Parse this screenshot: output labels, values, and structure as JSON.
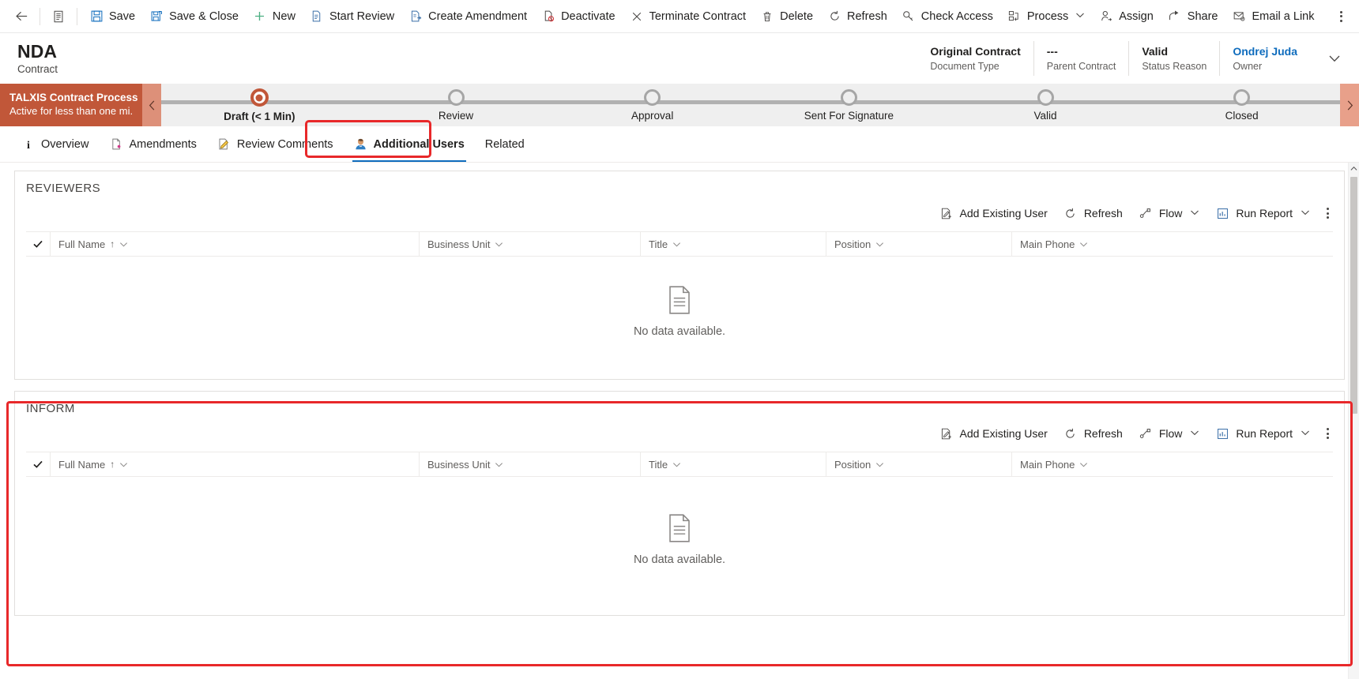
{
  "commandbar": {
    "back_icon": "back-arrow-icon",
    "form_selector_icon": "form-list-icon",
    "buttons": [
      {
        "label": "Save",
        "icon": "save-icon"
      },
      {
        "label": "Save & Close",
        "icon": "save-close-icon"
      },
      {
        "label": "New",
        "icon": "plus-icon"
      },
      {
        "label": "Start Review",
        "icon": "document-review-icon"
      },
      {
        "label": "Create Amendment",
        "icon": "document-amend-icon"
      },
      {
        "label": "Deactivate",
        "icon": "document-deactivate-icon"
      },
      {
        "label": "Terminate Contract",
        "icon": "close-x-icon"
      },
      {
        "label": "Delete",
        "icon": "trash-icon"
      },
      {
        "label": "Refresh",
        "icon": "refresh-icon"
      },
      {
        "label": "Check Access",
        "icon": "key-icon"
      },
      {
        "label": "Process",
        "icon": "process-icon",
        "has_chevron": true
      },
      {
        "label": "Assign",
        "icon": "assign-person-icon"
      },
      {
        "label": "Share",
        "icon": "share-icon"
      },
      {
        "label": "Email a Link",
        "icon": "email-link-icon"
      }
    ],
    "overflow_label": "More commands"
  },
  "record_header": {
    "title": "NDA",
    "subtitle": "Contract",
    "fields": [
      {
        "value": "Original Contract",
        "label": "Document Type",
        "is_link": false
      },
      {
        "value": "---",
        "label": "Parent Contract",
        "is_link": false
      },
      {
        "value": "Valid",
        "label": "Status Reason",
        "is_link": false
      },
      {
        "value": "Ondrej Juda",
        "label": "Owner",
        "is_link": true
      }
    ],
    "expand_icon": "chevron-down-icon"
  },
  "process_flow": {
    "name": "TALXIS Contract Process",
    "status": "Active for less than one mi...",
    "prev_icon": "chevron-left-icon",
    "next_icon": "chevron-right-icon",
    "header_color": "#c15739",
    "stages": [
      {
        "label": "Draft  (< 1 Min)",
        "active": true
      },
      {
        "label": "Review",
        "active": false
      },
      {
        "label": "Approval",
        "active": false
      },
      {
        "label": "Sent For Signature",
        "active": false
      },
      {
        "label": "Valid",
        "active": false
      },
      {
        "label": "Closed",
        "active": false
      }
    ]
  },
  "tabs": [
    {
      "label": "Overview",
      "icon": "info-icon",
      "active": false
    },
    {
      "label": "Amendments",
      "icon": "document-pin-icon",
      "active": false
    },
    {
      "label": "Review Comments",
      "icon": "document-pencil-icon",
      "active": false
    },
    {
      "label": "Additional Users",
      "icon": "person-icon",
      "active": true
    },
    {
      "label": "Related",
      "icon": "",
      "active": false
    }
  ],
  "grid_toolbar": {
    "add_existing_label": "Add Existing User",
    "add_existing_icon": "add-user-icon",
    "refresh_label": "Refresh",
    "refresh_icon": "refresh-icon",
    "flow_label": "Flow",
    "flow_icon": "flow-icon",
    "run_report_label": "Run Report",
    "run_report_icon": "report-icon",
    "overflow_label": "More commands"
  },
  "grid_columns": [
    {
      "label": "Full Name",
      "sorted": true,
      "sort_dir": "↑"
    },
    {
      "label": "Business Unit",
      "sorted": false,
      "sort_dir": ""
    },
    {
      "label": "Title",
      "sorted": false,
      "sort_dir": ""
    },
    {
      "label": "Position",
      "sorted": false,
      "sort_dir": ""
    },
    {
      "label": "Main Phone",
      "sorted": false,
      "sort_dir": ""
    }
  ],
  "sections": [
    {
      "title": "REVIEWERS",
      "empty_message": "No data available.",
      "empty_icon": "empty-document-icon",
      "annotated": false
    },
    {
      "title": "INFORM",
      "empty_message": "No data available.",
      "empty_icon": "empty-document-icon",
      "annotated": true
    }
  ],
  "annotations": {
    "color": "#e8282a",
    "tab_target": "Additional Users",
    "section_target": "INFORM"
  },
  "scrollbar": {
    "up_icon": "scroll-up-icon",
    "down_icon": "scroll-down-icon"
  }
}
